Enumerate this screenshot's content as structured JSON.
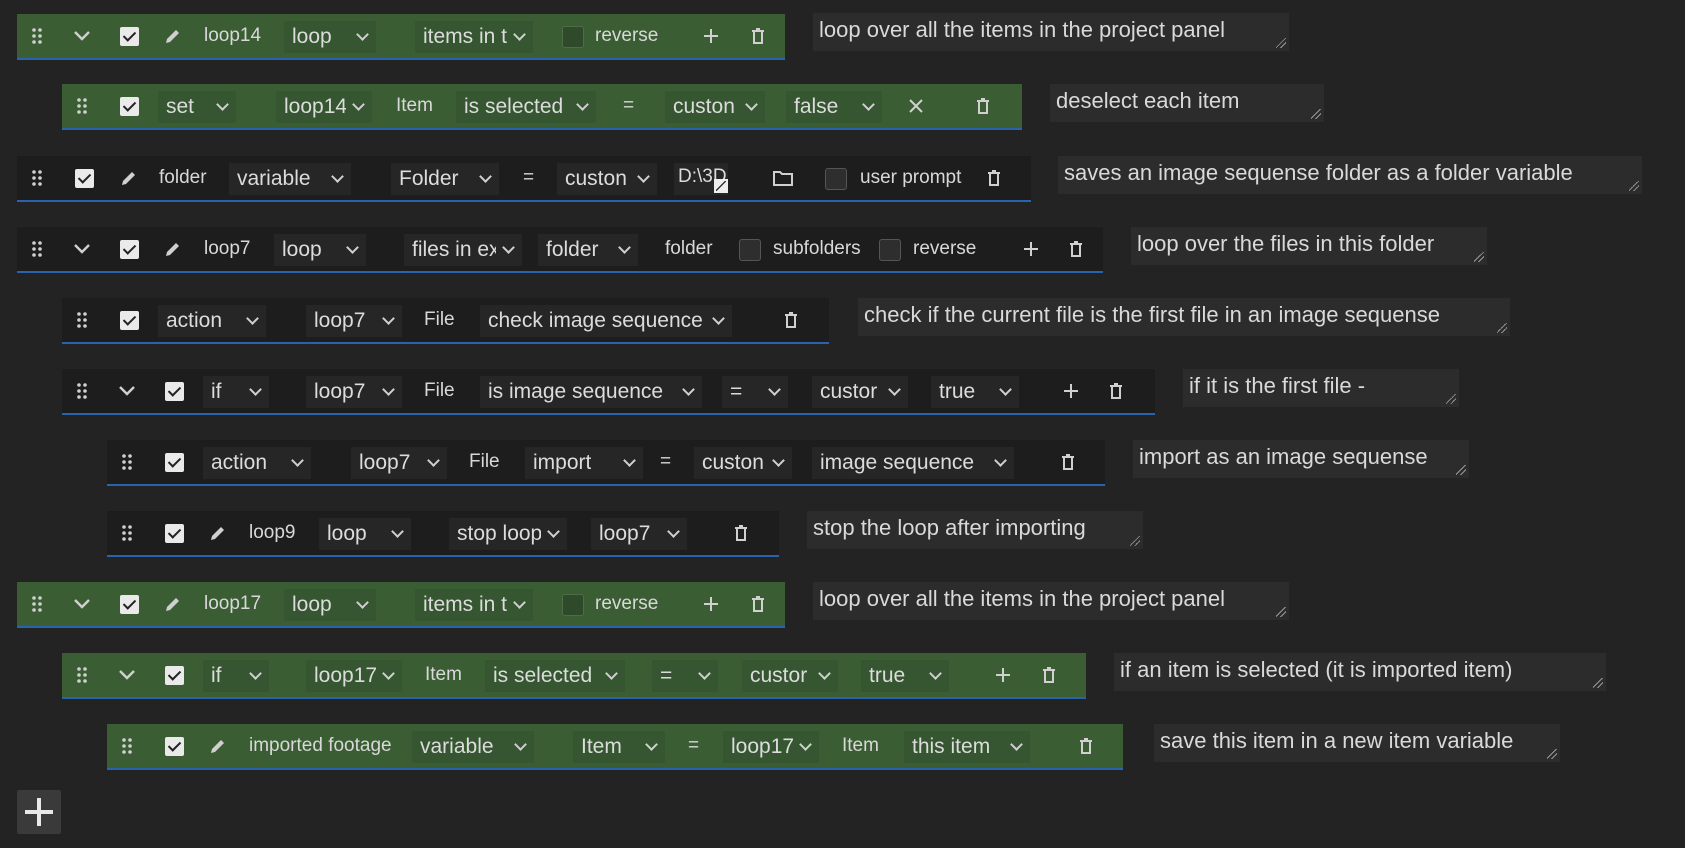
{
  "rows": [
    {
      "name": "loop14",
      "drop": "loop",
      "src": "items in t",
      "reverse": "reverse",
      "comment": "loop over all the items in the project panel"
    },
    {
      "set": "set",
      "obj": "loop14",
      "type": "Item",
      "prop": "is selected",
      "eq": "=",
      "mode": "custon",
      "val": "false",
      "comment": "deselect each item"
    },
    {
      "name": "folder",
      "drop": "variable",
      "type": "Folder",
      "eq": "=",
      "mode": "custon",
      "path": "D:\\3D",
      "prompt": "user prompt",
      "comment": "saves an image sequense folder as a folder variable"
    },
    {
      "name": "loop7",
      "drop": "loop",
      "src": "files in ex",
      "srcType": "folder",
      "folderLabel": "folder",
      "subfolders": "subfolders",
      "reverse": "reverse",
      "comment": "loop over the files in this folder"
    },
    {
      "action": "action",
      "obj": "loop7",
      "type": "File",
      "cmd": "check image sequence",
      "comment": "check if the current file is the first file in an image sequense"
    },
    {
      "cond": "if",
      "obj": "loop7",
      "type": "File",
      "prop": "is image sequence",
      "eq": "=",
      "mode": "custor",
      "val": "true",
      "comment": "if it is the first file -"
    },
    {
      "action": "action",
      "obj": "loop7",
      "type": "File",
      "cmd": "import",
      "eq": "=",
      "mode": "custon",
      "val": "image sequence",
      "comment": "import as an image sequense"
    },
    {
      "name": "loop9",
      "drop": "loop",
      "cmd": "stop loop",
      "target": "loop7",
      "comment": "stop the loop after importing"
    },
    {
      "name": "loop17",
      "drop": "loop",
      "src": "items in t",
      "reverse": "reverse",
      "comment": "loop over all the items in the project panel"
    },
    {
      "cond": "if",
      "obj": "loop17",
      "type": "Item",
      "prop": "is selected",
      "eq": "=",
      "mode": "custor",
      "val": "true",
      "comment": "if an item is selected (it is imported item)"
    },
    {
      "name": "imported footage",
      "drop": "variable",
      "type": "Item",
      "eq": "=",
      "obj": "loop17",
      "type2": "Item",
      "prop": "this item",
      "comment": "save this item in a new item variable"
    }
  ]
}
